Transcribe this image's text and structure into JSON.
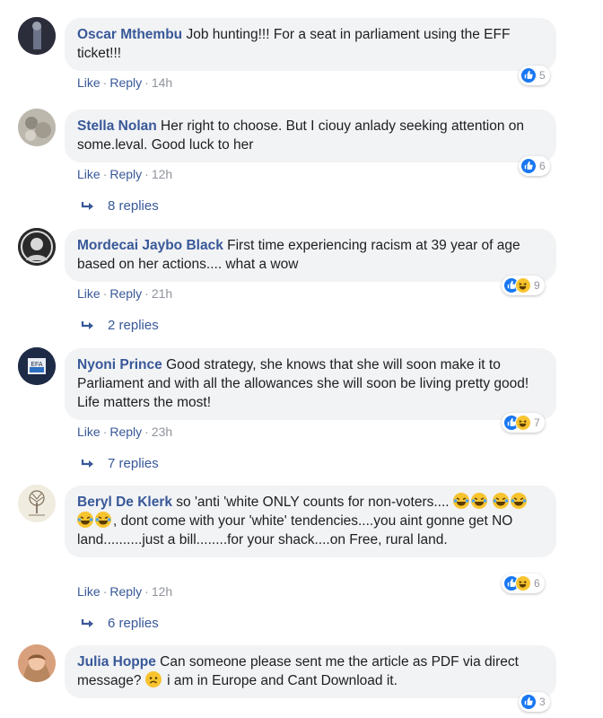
{
  "comments": [
    {
      "author": "Oscar Mthembu",
      "text": "Job hunting!!! For a seat in parliament using the EFF ticket!!!",
      "like_label": "Like",
      "reply_label": "Reply",
      "time": "14h",
      "reaction_count": "5",
      "reactions": [
        "like-icon"
      ]
    },
    {
      "author": "Stella Nolan",
      "text": "Her right to choose. But I ciouy anlady seeking attention on some.leval. Good luck to her",
      "like_label": "Like",
      "reply_label": "Reply",
      "time": "12h",
      "reaction_count": "6",
      "reactions": [
        "like-icon"
      ],
      "replies": "8 replies"
    },
    {
      "author": "Mordecai Jaybo Black",
      "text": "First time experiencing racism at 39 year of age based on her actions.... what a wow",
      "like_label": "Like",
      "reply_label": "Reply",
      "time": "21h",
      "reaction_count": "9",
      "reactions": [
        "like-icon",
        "haha-icon"
      ],
      "replies": "2 replies"
    },
    {
      "author": "Nyoni Prince",
      "text": "Good strategy, she knows that she will soon make it to Parliament and with all the allowances she will soon be living pretty good! Life matters the most!",
      "like_label": "Like",
      "reply_label": "Reply",
      "time": "23h",
      "reaction_count": "7",
      "reactions": [
        "like-icon",
        "haha-icon"
      ],
      "replies": "7 replies"
    },
    {
      "author": "Beryl De Klerk",
      "text_a": "so 'anti 'white ONLY counts for non-voters....",
      "text_b": ", dont come with your 'white' tendencies....you aint gonne get NO land..........just a bill........for your shack....on Free, rural land.",
      "like_label": "Like",
      "reply_label": "Reply",
      "time": "12h",
      "reaction_count": "6",
      "reactions": [
        "like-icon",
        "haha-icon"
      ],
      "replies": "6 replies"
    },
    {
      "author": "Julia Hoppe",
      "text_a": "Can someone please sent me the article as PDF via direct message?",
      "text_b": "i am in Europe and Cant Download it.",
      "reaction_count": "3",
      "reactions": [
        "like-icon"
      ]
    }
  ],
  "colors": {
    "link": "#385898",
    "bubble": "#f2f3f5",
    "like": "#1877f2",
    "haha": "#f7c430"
  }
}
